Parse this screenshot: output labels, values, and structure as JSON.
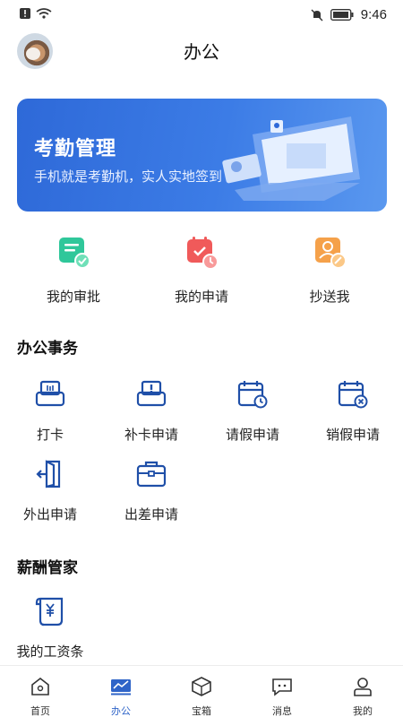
{
  "status_bar": {
    "time": "9:46"
  },
  "header": {
    "title": "办公"
  },
  "banner": {
    "title": "考勤管理",
    "subtitle": "手机就是考勤机，实人实地签到"
  },
  "quick_actions": [
    {
      "label": "我的审批",
      "icon": "approval-icon"
    },
    {
      "label": "我的申请",
      "icon": "application-icon"
    },
    {
      "label": "抄送我",
      "icon": "cc-me-icon"
    }
  ],
  "office_affairs": {
    "title": "办公事务",
    "items": [
      {
        "label": "打卡",
        "icon": "clock-in-icon"
      },
      {
        "label": "补卡申请",
        "icon": "makeup-clock-icon"
      },
      {
        "label": "请假申请",
        "icon": "leave-request-icon"
      },
      {
        "label": "销假申请",
        "icon": "cancel-leave-icon"
      },
      {
        "label": "外出申请",
        "icon": "go-out-icon"
      },
      {
        "label": "出差申请",
        "icon": "business-trip-icon"
      }
    ]
  },
  "salary": {
    "title": "薪酬管家",
    "items": [
      {
        "label": "我的工资条",
        "icon": "payslip-icon"
      }
    ]
  },
  "bottom_nav": {
    "active": "办公",
    "items": [
      {
        "label": "首页",
        "icon": "home-icon"
      },
      {
        "label": "办公",
        "icon": "office-icon"
      },
      {
        "label": "宝箱",
        "icon": "treasure-box-icon"
      },
      {
        "label": "消息",
        "icon": "message-icon"
      },
      {
        "label": "我的",
        "icon": "profile-icon"
      }
    ]
  },
  "colors": {
    "accent": "#2f64c8",
    "banner": "#3c7ce6",
    "approval": "#2fc79a",
    "application": "#f05a5a",
    "cc": "#f5a14a"
  }
}
